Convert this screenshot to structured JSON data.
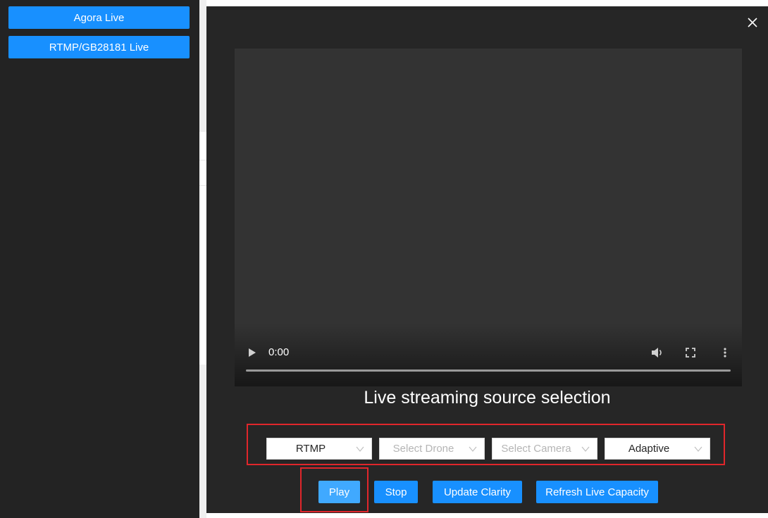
{
  "sidebar": {
    "buttons": [
      {
        "label": "Agora Live"
      },
      {
        "label": "RTMP/GB28181 Live"
      }
    ]
  },
  "modal": {
    "close_icon": "close-icon",
    "video": {
      "time": "0:00",
      "icons": [
        "play-icon",
        "volume-icon",
        "fullscreen-icon",
        "more-options-icon"
      ]
    },
    "title": "Live streaming source selection",
    "selects": [
      {
        "value": "RTMP",
        "placeholder": false
      },
      {
        "value": "Select Drone",
        "placeholder": true
      },
      {
        "value": "Select Camera",
        "placeholder": true
      },
      {
        "value": "Adaptive",
        "placeholder": false
      }
    ],
    "actions": {
      "play": "Play",
      "stop": "Stop",
      "update_clarity": "Update Clarity",
      "refresh_capacity": "Refresh Live Capacity"
    }
  },
  "colors": {
    "primary": "#1890ff",
    "highlight_border": "#e0262b",
    "modal_bg": "#262626",
    "sidebar_bg": "#232323"
  }
}
